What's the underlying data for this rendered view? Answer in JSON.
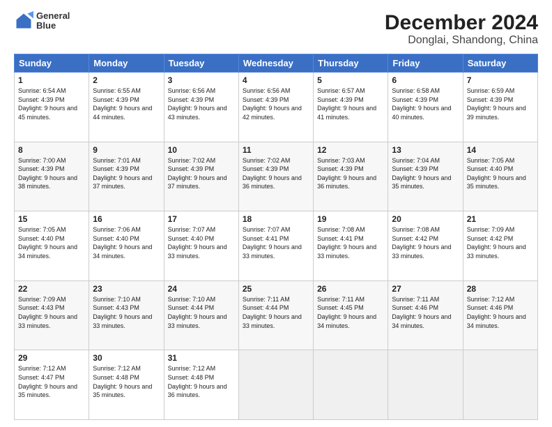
{
  "header": {
    "logo_line1": "General",
    "logo_line2": "Blue",
    "title": "December 2024",
    "subtitle": "Donglai, Shandong, China"
  },
  "weekdays": [
    "Sunday",
    "Monday",
    "Tuesday",
    "Wednesday",
    "Thursday",
    "Friday",
    "Saturday"
  ],
  "weeks": [
    [
      {
        "day": "1",
        "sunrise": "Sunrise: 6:54 AM",
        "sunset": "Sunset: 4:39 PM",
        "daylight": "Daylight: 9 hours and 45 minutes."
      },
      {
        "day": "2",
        "sunrise": "Sunrise: 6:55 AM",
        "sunset": "Sunset: 4:39 PM",
        "daylight": "Daylight: 9 hours and 44 minutes."
      },
      {
        "day": "3",
        "sunrise": "Sunrise: 6:56 AM",
        "sunset": "Sunset: 4:39 PM",
        "daylight": "Daylight: 9 hours and 43 minutes."
      },
      {
        "day": "4",
        "sunrise": "Sunrise: 6:56 AM",
        "sunset": "Sunset: 4:39 PM",
        "daylight": "Daylight: 9 hours and 42 minutes."
      },
      {
        "day": "5",
        "sunrise": "Sunrise: 6:57 AM",
        "sunset": "Sunset: 4:39 PM",
        "daylight": "Daylight: 9 hours and 41 minutes."
      },
      {
        "day": "6",
        "sunrise": "Sunrise: 6:58 AM",
        "sunset": "Sunset: 4:39 PM",
        "daylight": "Daylight: 9 hours and 40 minutes."
      },
      {
        "day": "7",
        "sunrise": "Sunrise: 6:59 AM",
        "sunset": "Sunset: 4:39 PM",
        "daylight": "Daylight: 9 hours and 39 minutes."
      }
    ],
    [
      {
        "day": "8",
        "sunrise": "Sunrise: 7:00 AM",
        "sunset": "Sunset: 4:39 PM",
        "daylight": "Daylight: 9 hours and 38 minutes."
      },
      {
        "day": "9",
        "sunrise": "Sunrise: 7:01 AM",
        "sunset": "Sunset: 4:39 PM",
        "daylight": "Daylight: 9 hours and 37 minutes."
      },
      {
        "day": "10",
        "sunrise": "Sunrise: 7:02 AM",
        "sunset": "Sunset: 4:39 PM",
        "daylight": "Daylight: 9 hours and 37 minutes."
      },
      {
        "day": "11",
        "sunrise": "Sunrise: 7:02 AM",
        "sunset": "Sunset: 4:39 PM",
        "daylight": "Daylight: 9 hours and 36 minutes."
      },
      {
        "day": "12",
        "sunrise": "Sunrise: 7:03 AM",
        "sunset": "Sunset: 4:39 PM",
        "daylight": "Daylight: 9 hours and 36 minutes."
      },
      {
        "day": "13",
        "sunrise": "Sunrise: 7:04 AM",
        "sunset": "Sunset: 4:39 PM",
        "daylight": "Daylight: 9 hours and 35 minutes."
      },
      {
        "day": "14",
        "sunrise": "Sunrise: 7:05 AM",
        "sunset": "Sunset: 4:40 PM",
        "daylight": "Daylight: 9 hours and 35 minutes."
      }
    ],
    [
      {
        "day": "15",
        "sunrise": "Sunrise: 7:05 AM",
        "sunset": "Sunset: 4:40 PM",
        "daylight": "Daylight: 9 hours and 34 minutes."
      },
      {
        "day": "16",
        "sunrise": "Sunrise: 7:06 AM",
        "sunset": "Sunset: 4:40 PM",
        "daylight": "Daylight: 9 hours and 34 minutes."
      },
      {
        "day": "17",
        "sunrise": "Sunrise: 7:07 AM",
        "sunset": "Sunset: 4:40 PM",
        "daylight": "Daylight: 9 hours and 33 minutes."
      },
      {
        "day": "18",
        "sunrise": "Sunrise: 7:07 AM",
        "sunset": "Sunset: 4:41 PM",
        "daylight": "Daylight: 9 hours and 33 minutes."
      },
      {
        "day": "19",
        "sunrise": "Sunrise: 7:08 AM",
        "sunset": "Sunset: 4:41 PM",
        "daylight": "Daylight: 9 hours and 33 minutes."
      },
      {
        "day": "20",
        "sunrise": "Sunrise: 7:08 AM",
        "sunset": "Sunset: 4:42 PM",
        "daylight": "Daylight: 9 hours and 33 minutes."
      },
      {
        "day": "21",
        "sunrise": "Sunrise: 7:09 AM",
        "sunset": "Sunset: 4:42 PM",
        "daylight": "Daylight: 9 hours and 33 minutes."
      }
    ],
    [
      {
        "day": "22",
        "sunrise": "Sunrise: 7:09 AM",
        "sunset": "Sunset: 4:43 PM",
        "daylight": "Daylight: 9 hours and 33 minutes."
      },
      {
        "day": "23",
        "sunrise": "Sunrise: 7:10 AM",
        "sunset": "Sunset: 4:43 PM",
        "daylight": "Daylight: 9 hours and 33 minutes."
      },
      {
        "day": "24",
        "sunrise": "Sunrise: 7:10 AM",
        "sunset": "Sunset: 4:44 PM",
        "daylight": "Daylight: 9 hours and 33 minutes."
      },
      {
        "day": "25",
        "sunrise": "Sunrise: 7:11 AM",
        "sunset": "Sunset: 4:44 PM",
        "daylight": "Daylight: 9 hours and 33 minutes."
      },
      {
        "day": "26",
        "sunrise": "Sunrise: 7:11 AM",
        "sunset": "Sunset: 4:45 PM",
        "daylight": "Daylight: 9 hours and 34 minutes."
      },
      {
        "day": "27",
        "sunrise": "Sunrise: 7:11 AM",
        "sunset": "Sunset: 4:46 PM",
        "daylight": "Daylight: 9 hours and 34 minutes."
      },
      {
        "day": "28",
        "sunrise": "Sunrise: 7:12 AM",
        "sunset": "Sunset: 4:46 PM",
        "daylight": "Daylight: 9 hours and 34 minutes."
      }
    ],
    [
      {
        "day": "29",
        "sunrise": "Sunrise: 7:12 AM",
        "sunset": "Sunset: 4:47 PM",
        "daylight": "Daylight: 9 hours and 35 minutes."
      },
      {
        "day": "30",
        "sunrise": "Sunrise: 7:12 AM",
        "sunset": "Sunset: 4:48 PM",
        "daylight": "Daylight: 9 hours and 35 minutes."
      },
      {
        "day": "31",
        "sunrise": "Sunrise: 7:12 AM",
        "sunset": "Sunset: 4:48 PM",
        "daylight": "Daylight: 9 hours and 36 minutes."
      },
      null,
      null,
      null,
      null
    ]
  ]
}
